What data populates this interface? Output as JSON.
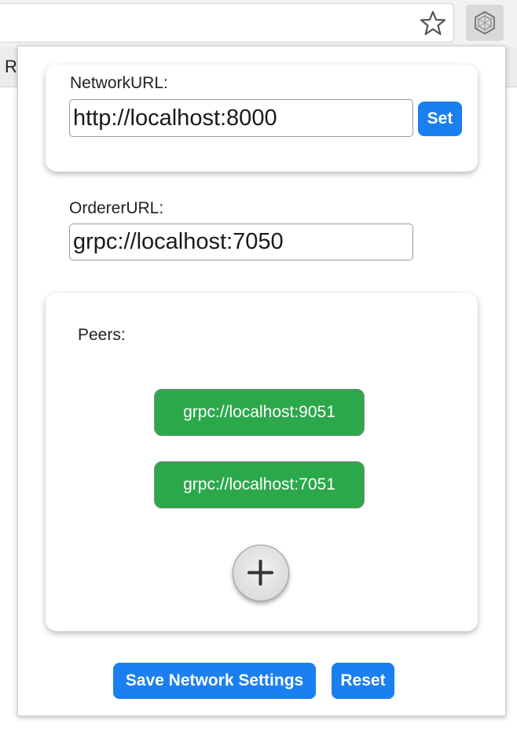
{
  "browser": {
    "page_letter": "R",
    "icons": {
      "bookmark": "star-icon",
      "extension": "hyperledger-icon"
    }
  },
  "network": {
    "label": "NetworkURL:",
    "value": "http://localhost:8000",
    "set_label": "Set"
  },
  "orderer": {
    "label": "OrdererURL:",
    "value": "grpc://localhost:7050"
  },
  "peers": {
    "label": "Peers:",
    "items": [
      {
        "label": "grpc://localhost:9051"
      },
      {
        "label": "grpc://localhost:7051"
      }
    ],
    "add_icon": "plus-icon"
  },
  "footer": {
    "save_label": "Save Network Settings",
    "reset_label": "Reset"
  },
  "colors": {
    "primary": "#1a7ff0",
    "peer": "#2ba84a"
  }
}
